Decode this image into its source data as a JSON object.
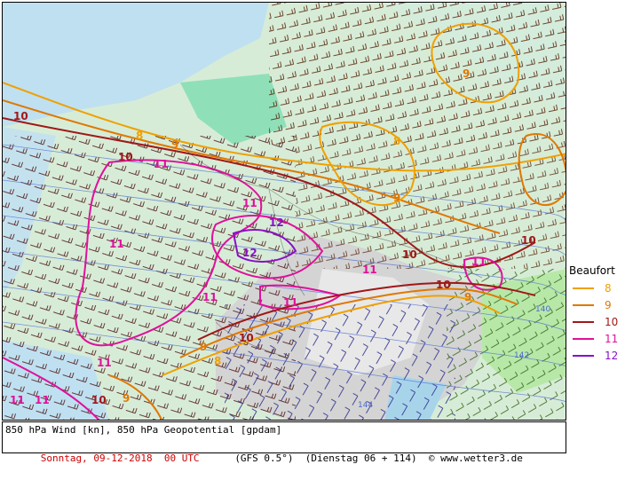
{
  "map": {
    "footer": {
      "line1": "850 hPa Wind [kn], 850 hPa Geopotential [gpdam]",
      "date": "Sonntag, 09-12-2018  00 UTC",
      "model": "(GFS 0.5°)",
      "run": "(Dienstag 06 + 114)",
      "credit": "© www.wetter3.de"
    },
    "legend": {
      "title": "Beaufort",
      "items": [
        {
          "label": "8",
          "color": "#f0a000"
        },
        {
          "label": "9",
          "color": "#e07800"
        },
        {
          "label": "10",
          "color": "#a01818"
        },
        {
          "label": "11",
          "color": "#e0109c"
        },
        {
          "label": "12",
          "color": "#8a10c8"
        }
      ]
    },
    "contour_labels": [
      "10",
      "9",
      "8",
      "9",
      "11",
      "10",
      "11",
      "11",
      "12",
      "12",
      "11",
      "11",
      "11",
      "10",
      "11",
      "11",
      "10",
      "9",
      "8",
      "10",
      "9",
      "10",
      "9",
      "11",
      "8",
      "9",
      "10",
      "11",
      "140",
      "142",
      "144"
    ]
  }
}
